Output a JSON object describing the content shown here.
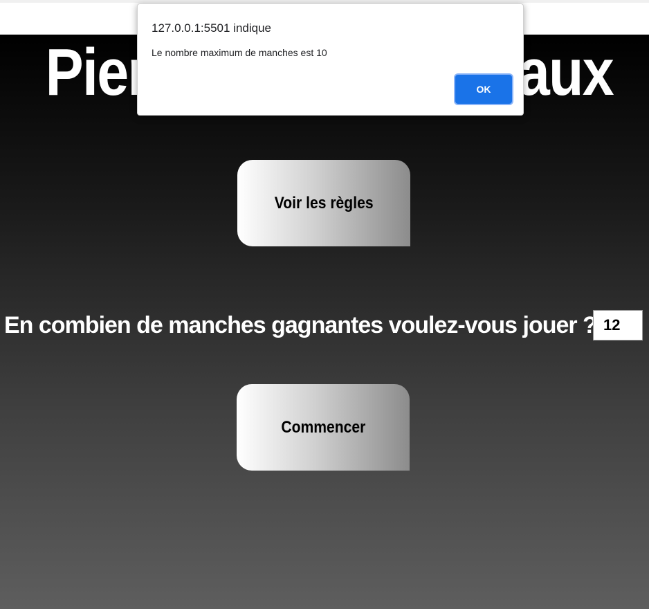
{
  "page": {
    "title": "Pierre Feuille Ciseaux",
    "rules_button": "Voir les règles",
    "question": "En combien de manches gagnantes voulez-vous jouer ?",
    "rounds_value": "12",
    "start_button": "Commencer"
  },
  "alert": {
    "origin": "127.0.0.1:5501 indique",
    "message": "Le nombre maximum de manches est 10",
    "ok_label": "OK"
  },
  "colors": {
    "ok_button": "#1a73e8",
    "title_text": "#ffffff",
    "background_top": "#000000",
    "background_bottom": "#5e5e5e"
  }
}
